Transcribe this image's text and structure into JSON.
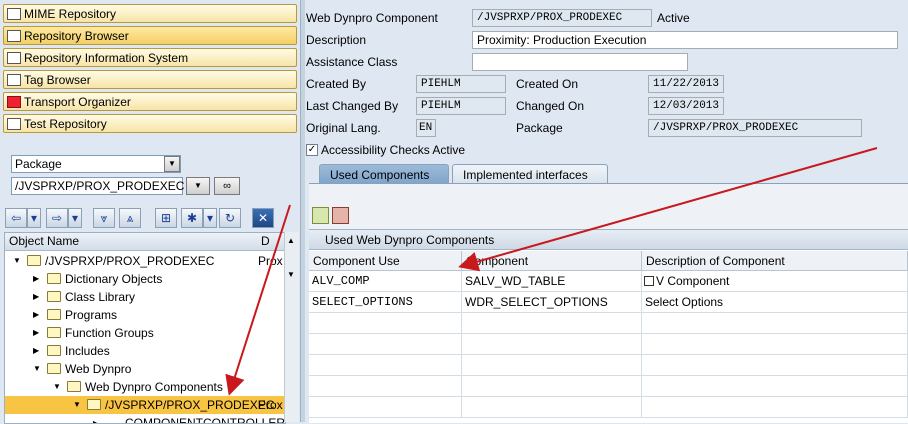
{
  "nav": {
    "buttons": [
      {
        "label": "MIME Repository"
      },
      {
        "label": "Repository Browser"
      },
      {
        "label": "Repository Information System"
      },
      {
        "label": "Tag Browser"
      },
      {
        "label": "Transport Organizer"
      },
      {
        "label": "Test Repository"
      }
    ],
    "object_type": "Package",
    "object_value": "/JVSPRXP/PROX_PRODEXEC"
  },
  "tree": {
    "col_object_name": "Object Name",
    "col_desc": "D",
    "rows": [
      {
        "label": "/JVSPRXP/PROX_PRODEXEC",
        "desc": "Prox"
      },
      {
        "label": "Dictionary Objects"
      },
      {
        "label": "Class Library"
      },
      {
        "label": "Programs"
      },
      {
        "label": "Function Groups"
      },
      {
        "label": "Includes"
      },
      {
        "label": "Web Dynpro"
      },
      {
        "label": "Web Dynpro Components"
      },
      {
        "label": "/JVSPRXP/PROX_PRODEXEC",
        "desc": "Prox"
      },
      {
        "label": "COMPONENTCONTROLLER"
      }
    ]
  },
  "form": {
    "component_label": "Web Dynpro Component",
    "component_value": "/JVSPRXP/PROX_PRODEXEC",
    "status": "Active",
    "description_label": "Description",
    "description_value": "Proximity: Production Execution",
    "assistance_label": "Assistance Class",
    "assistance_value": "",
    "created_by_label": "Created By",
    "created_by_value": "PIEHLM",
    "created_on_label": "Created On",
    "created_on_value": "11/22/2013",
    "changed_by_label": "Last Changed By",
    "changed_by_value": "PIEHLM",
    "changed_on_label": "Changed On",
    "changed_on_value": "12/03/2013",
    "orig_lang_label": "Original Lang.",
    "orig_lang_value": "EN",
    "package_label": "Package",
    "package_value": "/JVSPRXP/PROX_PRODEXEC",
    "accessibility_label": "Accessibility Checks Active"
  },
  "tabs": [
    {
      "label": "Used Components"
    },
    {
      "label": "Implemented interfaces"
    }
  ],
  "grid": {
    "title": "Used Web Dynpro Components",
    "headers": [
      "Component Use",
      "Component",
      "Description of Component"
    ],
    "rows": [
      [
        "ALV_COMP",
        "SALV_WD_TABLE",
        "V Component"
      ],
      [
        "SELECT_OPTIONS",
        "WDR_SELECT_OPTIONS",
        "Select Options"
      ]
    ]
  },
  "colors": {
    "nav_button": "#f7e4a6",
    "nav_border": "#b89a3c",
    "annotation_arrow": "#c8191e",
    "background": "#dfe8f2"
  }
}
